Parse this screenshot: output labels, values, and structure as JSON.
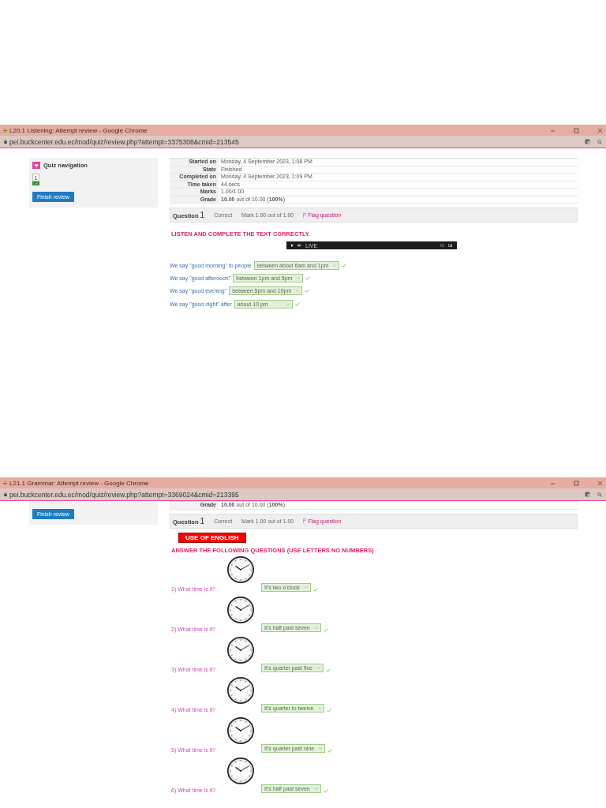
{
  "windows": [
    {
      "title": "L20.1 Listening: Attempt review - Google Chrome",
      "url": "pei.buckcenter.edu.ec/mod/quiz/review.php?attempt=3375308&cmid=213545",
      "quiz_navigation": {
        "title": "Quiz navigation",
        "buttons": [
          {
            "label": "1",
            "correct": true
          }
        ],
        "finish": "Finish review"
      },
      "summary": [
        {
          "label": "Started on",
          "value": "Monday, 4 September 2023, 1:08 PM"
        },
        {
          "label": "State",
          "value": "Finished"
        },
        {
          "label": "Completed on",
          "value": "Monday, 4 September 2023, 1:09 PM"
        },
        {
          "label": "Time taken",
          "value": "44 secs"
        },
        {
          "label": "Marks",
          "value": "1.00/1.00"
        },
        {
          "label": "Grade",
          "value": "**10.00** out of 10.00 (**100%**)"
        }
      ],
      "question": {
        "label": "Question",
        "number": "1",
        "status": "Correct",
        "mark": "Mark 1.00 out of 1.00",
        "flag": "Flag question"
      },
      "instruction": "LISTEN AND COMPLETE THE TEXT CORRECTLY.",
      "audio": {
        "status": "LIVE"
      },
      "items": [
        {
          "kind": "sentence",
          "prompt": "We say \"good morning\" to people",
          "answer": "between about 6am and 1pm",
          "correct": true
        },
        {
          "kind": "sentence",
          "prompt": "We say \"good afternoon\"",
          "answer": "between 1pm and 5pm",
          "correct": true
        },
        {
          "kind": "sentence",
          "prompt": "We say \"good evening\"",
          "answer": "between 5pm and 10pm",
          "correct": true
        },
        {
          "kind": "sentence",
          "prompt": "We say \"good night\" after",
          "answer": "about 10 pm",
          "correct": true
        }
      ]
    },
    {
      "title": "L21.1 Grammar: Attempt review - Google Chrome",
      "url": "pei.buckcenter.edu.ec/mod/quiz/review.php?attempt=3369024&cmid=213395",
      "quiz_navigation": {
        "finish": "Finish review"
      },
      "summary": [
        {
          "label": "Grade",
          "value": "**10.00** out of 10.00 (**100%**)"
        }
      ],
      "question": {
        "label": "Question",
        "number": "1",
        "status": "Correct",
        "mark": "Mark 1.00 out of 1.00",
        "flag": "Flag question"
      },
      "banner": "USE OF ENGLISH",
      "instruction": "ANSWER THE FOLLOWING QUESTIONS (USE LETTERS NO NUMBERS)",
      "items": [
        {
          "kind": "clock",
          "prompt": "1) What time is it?",
          "answer": "It's two o'clock",
          "correct": true
        },
        {
          "kind": "clock",
          "prompt": "2) What time is it?",
          "answer": "It's half past seven",
          "correct": true
        },
        {
          "kind": "clock",
          "prompt": "3) What time is it?",
          "answer": "It's quarter past five",
          "correct": true
        },
        {
          "kind": "clock",
          "prompt": "4) What time is it?",
          "answer": "It's quarter to twelve",
          "correct": true
        },
        {
          "kind": "clock",
          "prompt": "5) What time is it?",
          "answer": "It's quarter past nine",
          "correct": true
        },
        {
          "kind": "clock",
          "prompt": "6) What time is it?",
          "answer": "It's half past seven",
          "correct": true
        }
      ]
    }
  ]
}
